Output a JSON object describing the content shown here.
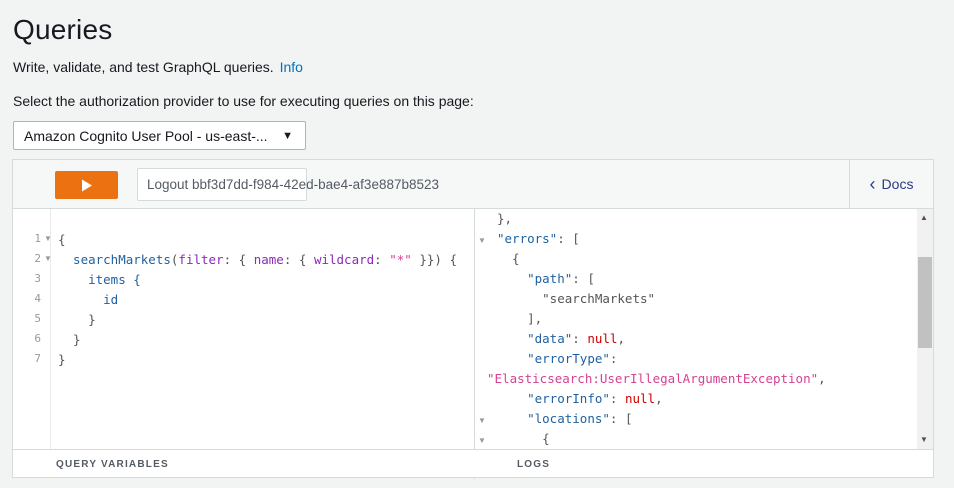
{
  "page": {
    "title": "Queries",
    "subtitle": "Write, validate, and test GraphQL queries.",
    "info_link": "Info",
    "auth_label": "Select the authorization provider to use for executing queries on this page:",
    "auth_selected": "Amazon Cognito User Pool - us-east-..."
  },
  "toolbar": {
    "run_icon": "play-icon",
    "logout_label": "Logout bbf3d7dd-f984-42ed-bae4-af3e887b8523",
    "docs_label": "Docs",
    "docs_icon": "chevron-left-icon",
    "run_color": "#ec7211"
  },
  "query": {
    "line_numbers": [
      "1",
      "2",
      "3",
      "4",
      "5",
      "6",
      "7"
    ],
    "lines": [
      "{",
      "  searchMarkets(filter: { name: { wildcard: \"*\" }}) {",
      "    items {",
      "      id",
      "    }",
      "  }",
      "}"
    ]
  },
  "result": {
    "lines": [
      "},",
      "\"errors\": [",
      "  {",
      "    \"path\": [",
      "      \"searchMarkets\"",
      "    ],",
      "    \"data\": null,",
      "    \"errorType\":",
      "\"Elasticsearch:UserIllegalArgumentException\",",
      "    \"errorInfo\": null,",
      "    \"locations\": [",
      "      {"
    ]
  },
  "footer": {
    "query_variables": "QUERY VARIABLES",
    "logs": "LOGS"
  }
}
